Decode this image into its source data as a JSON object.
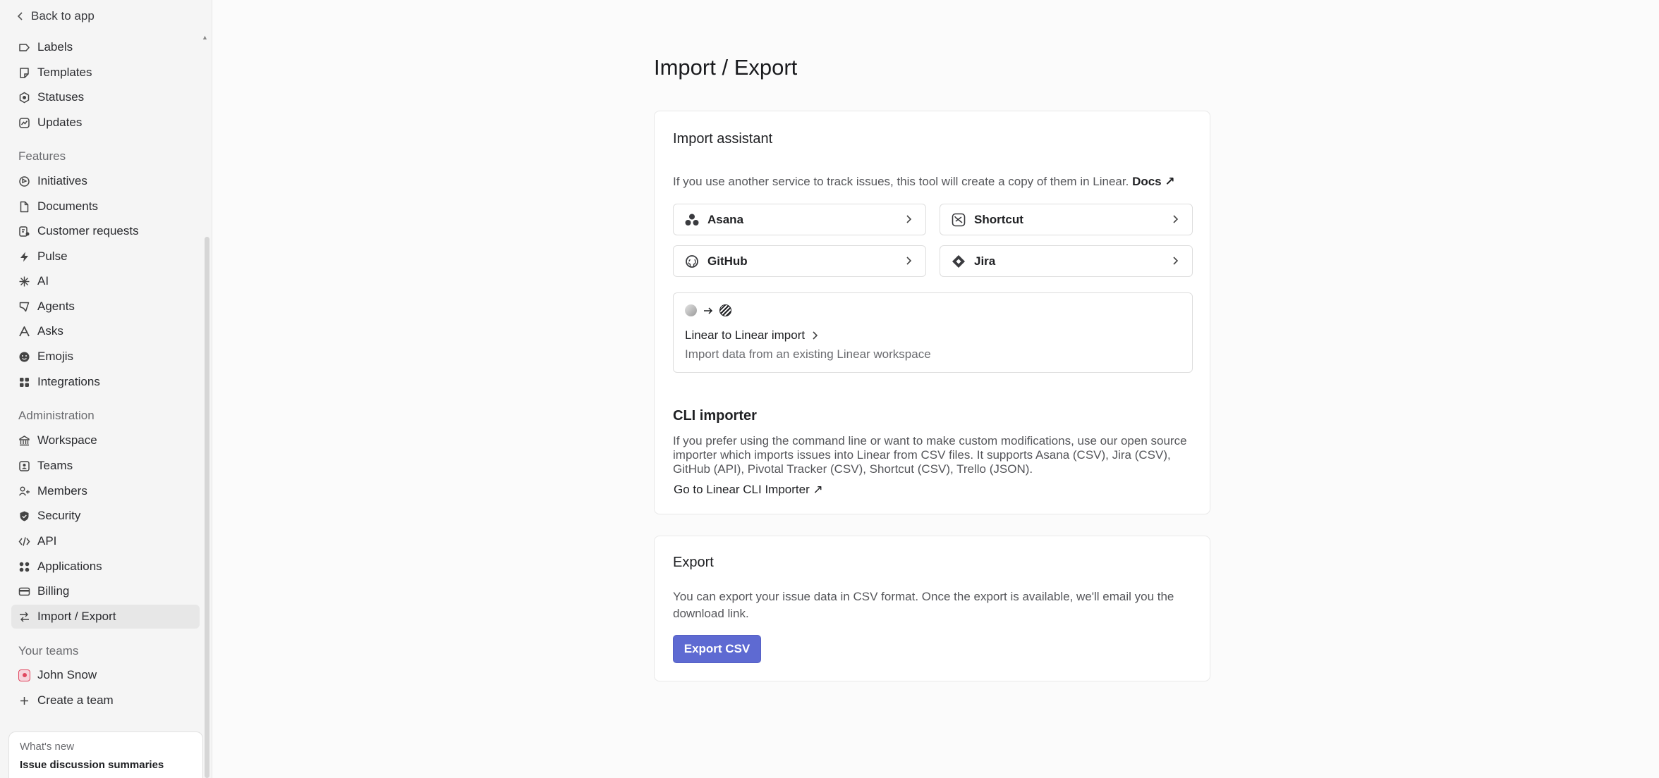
{
  "sidebar": {
    "back_label": "Back to app",
    "top_items": [
      {
        "label": "Labels",
        "icon": "label-icon"
      },
      {
        "label": "Templates",
        "icon": "template-icon"
      },
      {
        "label": "Statuses",
        "icon": "status-icon"
      },
      {
        "label": "Updates",
        "icon": "updates-icon"
      }
    ],
    "features_label": "Features",
    "features": [
      {
        "label": "Initiatives",
        "icon": "initiatives-icon"
      },
      {
        "label": "Documents",
        "icon": "document-icon"
      },
      {
        "label": "Customer requests",
        "icon": "customer-requests-icon"
      },
      {
        "label": "Pulse",
        "icon": "pulse-icon"
      },
      {
        "label": "AI",
        "icon": "ai-sparkle-icon"
      },
      {
        "label": "Agents",
        "icon": "agents-icon"
      },
      {
        "label": "Asks",
        "icon": "asks-icon"
      },
      {
        "label": "Emojis",
        "icon": "emoji-icon"
      },
      {
        "label": "Integrations",
        "icon": "integrations-icon"
      }
    ],
    "admin_label": "Administration",
    "admin": [
      {
        "label": "Workspace",
        "icon": "workspace-icon"
      },
      {
        "label": "Teams",
        "icon": "teams-icon"
      },
      {
        "label": "Members",
        "icon": "members-icon"
      },
      {
        "label": "Security",
        "icon": "shield-icon"
      },
      {
        "label": "API",
        "icon": "code-icon"
      },
      {
        "label": "Applications",
        "icon": "applications-icon"
      },
      {
        "label": "Billing",
        "icon": "billing-icon"
      },
      {
        "label": "Import / Export",
        "icon": "import-export-icon"
      }
    ],
    "teams_label": "Your teams",
    "team_name": "John Snow",
    "create_team": "Create a team",
    "whats_new_label": "What's new",
    "whats_new_title": "Issue discussion summaries"
  },
  "main": {
    "title": "Import / Export",
    "import": {
      "title": "Import assistant",
      "description": "If you use another service to track issues, this tool will create a copy of them in Linear.",
      "docs_label": "Docs ↗",
      "services": [
        "Asana",
        "Shortcut",
        "GitHub",
        "Jira"
      ],
      "l2l_title": "Linear to Linear import",
      "l2l_subtitle": "Import data from an existing Linear workspace",
      "cli_title": "CLI importer",
      "cli_text": "If you prefer using the command line or want to make custom modifications, use our open source importer which imports issues into Linear from CSV files. It supports Asana (CSV), Jira (CSV), GitHub (API), Pivotal Tracker (CSV), Shortcut (CSV), Trello (JSON).",
      "cli_link": "Go to Linear CLI Importer ↗"
    },
    "export": {
      "title": "Export",
      "description": "You can export your issue data in CSV format. Once the export is available, we'll email you the download link.",
      "button": "Export CSV"
    }
  },
  "colors": {
    "accent": "#5e6ad2",
    "team_badge": "#e0475f"
  }
}
